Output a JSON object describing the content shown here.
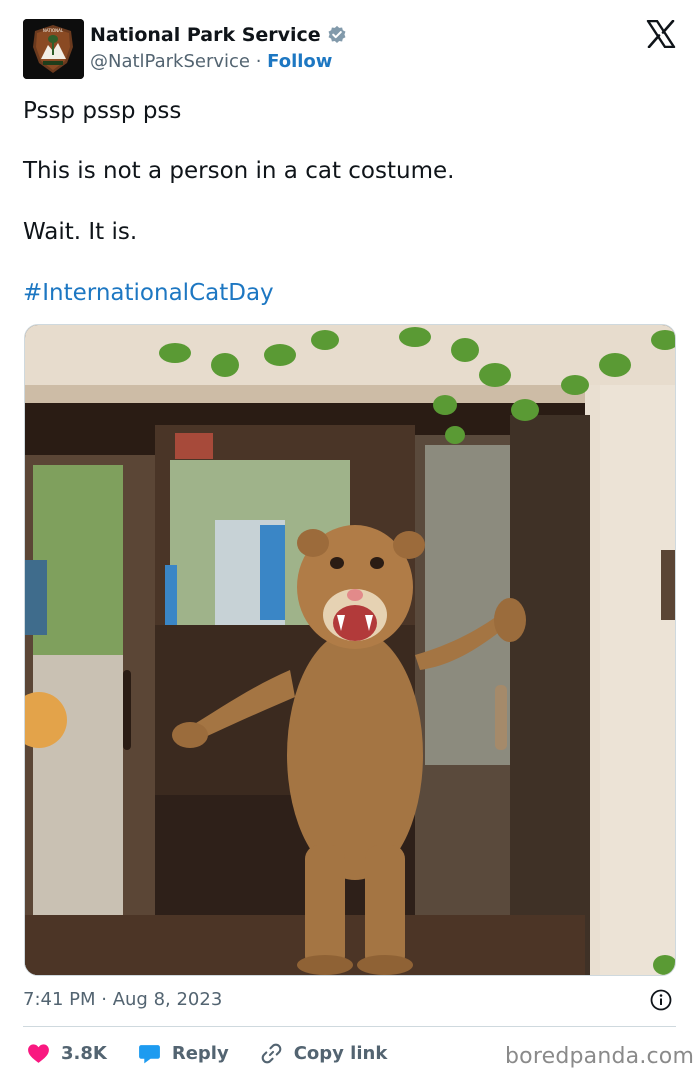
{
  "author": {
    "name": "National Park Service",
    "handle": "@NatlParkService",
    "separator": " · ",
    "follow_label": "Follow",
    "verified": true,
    "avatar_icon": "nps-arrowhead-logo"
  },
  "platform_icon": "x-logo-icon",
  "tweet": {
    "lines": [
      "Pssp pssp pss",
      "This is not a person in a cat costume.",
      "Wait. It is."
    ],
    "hashtag": "#InternationalCatDay",
    "media_icon": "person-in-cougar-costume-photo"
  },
  "meta": {
    "time": "7:41 PM",
    "separator": " · ",
    "date": "Aug 8, 2023"
  },
  "actions": {
    "likes_count": "3.8K",
    "reply_label": "Reply",
    "copy_link_label": "Copy link"
  },
  "watermark": "boredpanda.com",
  "colors": {
    "accent": "#1d77c2",
    "like": "#f91880",
    "reply": "#1d9bf0",
    "muted": "#536471"
  }
}
